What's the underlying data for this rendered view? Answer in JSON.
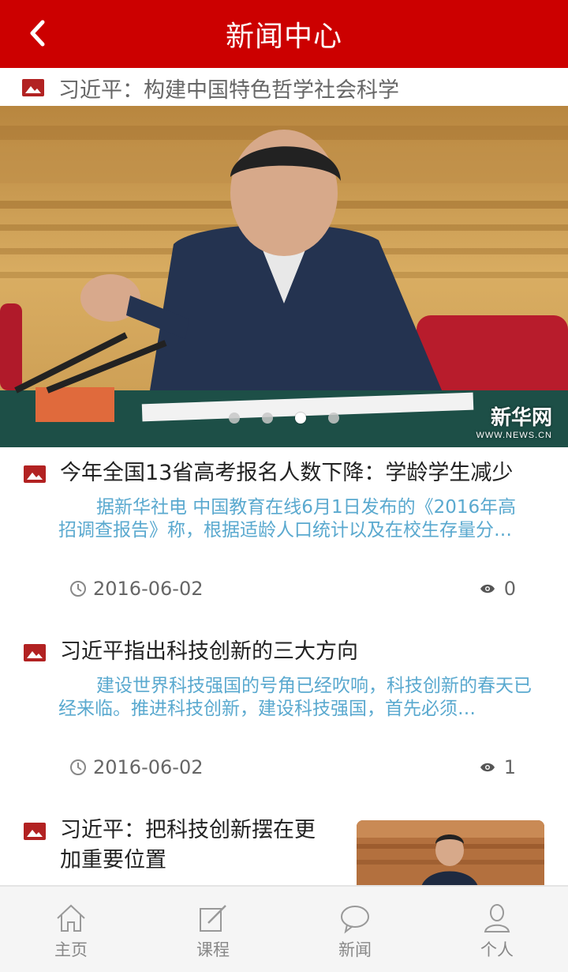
{
  "header": {
    "title": "新闻中心"
  },
  "featured": {
    "title": "习近平：构建中国特色哲学社会科学",
    "watermark_name": "新华网",
    "watermark_url": "WWW.NEWS.CN",
    "carousel_count": 4,
    "carousel_active": 3
  },
  "news": [
    {
      "title": "今年全国13省高考报名人数下降：学龄学生减少",
      "summary": "据新华社电 中国教育在线6月1日发布的《2016年高招调查报告》称，根据适龄人口统计以及在校生存量分…",
      "date": "2016-06-02",
      "views": "0"
    },
    {
      "title": "习近平指出科技创新的三大方向",
      "summary": "建设世界科技强国的号角已经吹响，科技创新的春天已经来临。推进科技创新，建设科技强国，首先必须…",
      "date": "2016-06-02",
      "views": "1"
    },
    {
      "title": "习近平：把科技创新摆在更加重要位置"
    }
  ],
  "tabs": [
    {
      "label": "主页",
      "icon": "home-icon"
    },
    {
      "label": "课程",
      "icon": "edit-icon"
    },
    {
      "label": "新闻",
      "icon": "chat-icon"
    },
    {
      "label": "个人",
      "icon": "user-icon"
    }
  ],
  "colors": {
    "brand": "#cc0000",
    "summary": "#5aa9cf",
    "tab": "#888888"
  }
}
